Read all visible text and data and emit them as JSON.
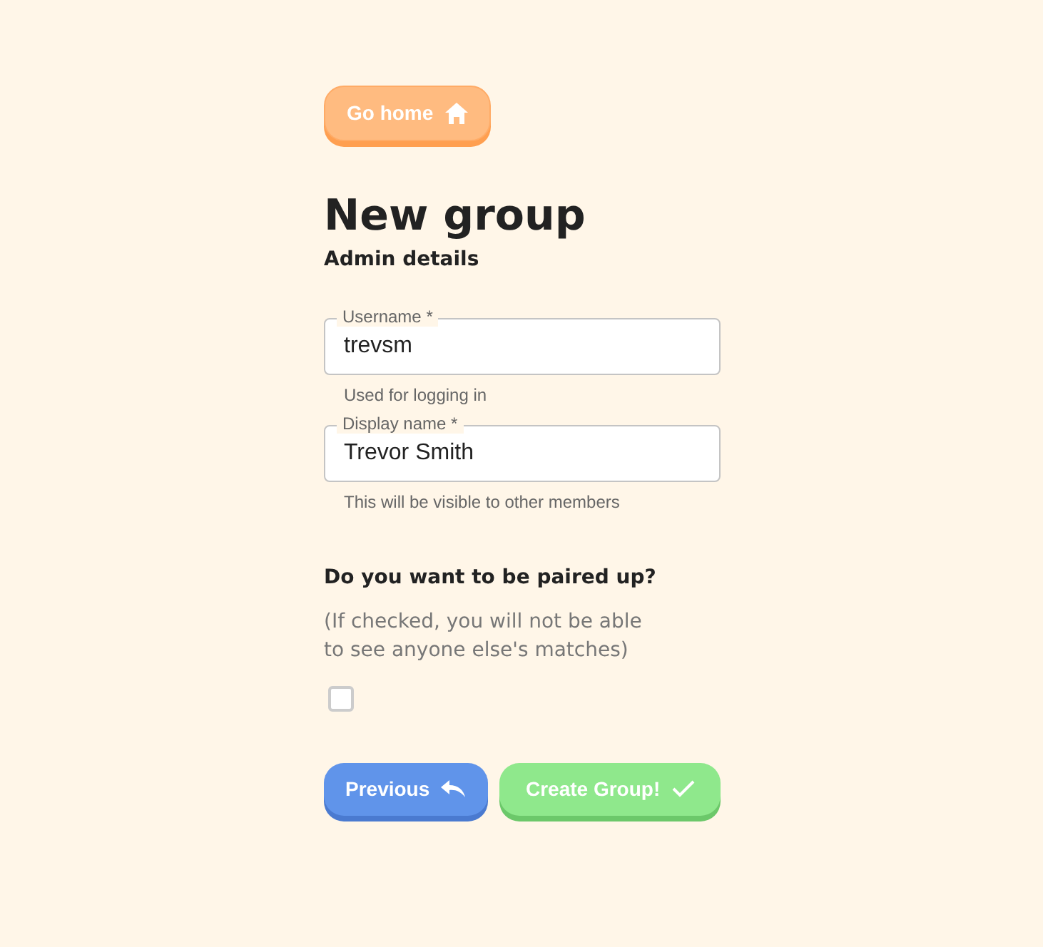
{
  "home_button": {
    "label": "Go home"
  },
  "title": "New group",
  "subtitle": "Admin details",
  "fields": [
    {
      "label": "Username *",
      "value": "trevsm",
      "helper": "Used for logging in"
    },
    {
      "label": "Display name *",
      "value": "Trevor Smith",
      "helper": "This will be visible to other members"
    }
  ],
  "pairing": {
    "question": "Do you want to be paired up?",
    "note": "(If checked, you will not be able to see anyone else's matches)",
    "checked": false
  },
  "buttons": [
    {
      "kind": "previous",
      "label": "Previous"
    },
    {
      "kind": "create",
      "label": "Create Group!"
    }
  ]
}
